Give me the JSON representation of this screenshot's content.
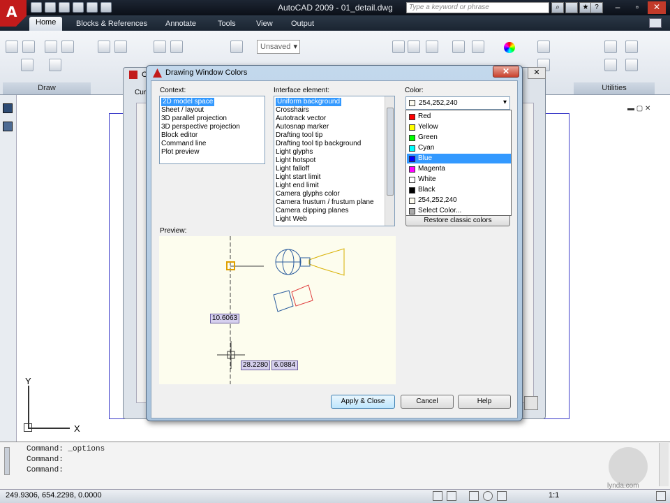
{
  "app": {
    "logo": "A",
    "window_title": "AutoCAD 2009 - 01_detail.dwg",
    "search_placeholder": "Type a keyword or phrase"
  },
  "ribbon": {
    "tabs": [
      "Home",
      "Blocks & References",
      "Annotate",
      "Tools",
      "View",
      "Output"
    ],
    "panels": {
      "draw": "Draw",
      "utilities": "Utilities"
    },
    "layer_value": "Unsaved"
  },
  "back_dialog": {
    "title": "O",
    "tab_label": "Cur"
  },
  "dialog": {
    "title": "Drawing Window Colors",
    "close_glyph": "✕",
    "context_label": "Context:",
    "context_items": [
      "2D model space",
      "Sheet / layout",
      "3D parallel projection",
      "3D perspective projection",
      "Block editor",
      "Command line",
      "Plot preview"
    ],
    "interface_label": "Interface element:",
    "interface_items": [
      "Uniform background",
      "Crosshairs",
      "Autotrack vector",
      "Autosnap marker",
      "Drafting tool tip",
      "Drafting tool tip background",
      "Light glyphs",
      "Light hotspot",
      "Light falloff",
      "Light start limit",
      "Light end limit",
      "Camera glyphs color",
      "Camera frustum / frustum plane",
      "Camera clipping planes",
      "Light Web"
    ],
    "color_label": "Color:",
    "color_value": "254,252,240",
    "color_options": [
      {
        "label": "Red",
        "swatch": "#ff0000"
      },
      {
        "label": "Yellow",
        "swatch": "#ffff00"
      },
      {
        "label": "Green",
        "swatch": "#00ff00"
      },
      {
        "label": "Cyan",
        "swatch": "#00ffff"
      },
      {
        "label": "Blue",
        "swatch": "#0000ff"
      },
      {
        "label": "Magenta",
        "swatch": "#ff00ff"
      },
      {
        "label": "White",
        "swatch": "#ffffff"
      },
      {
        "label": "Black",
        "swatch": "#000000"
      },
      {
        "label": "254,252,240",
        "swatch": "#fefcf0"
      },
      {
        "label": "Select Color...",
        "swatch": "#aaaaaa"
      }
    ],
    "restore_label": "Restore classic colors",
    "preview_label": "Preview:",
    "preview_values": {
      "v1": "10.6063",
      "v2": "28.2280",
      "v3": "6.0884"
    },
    "apply_label": "Apply & Close",
    "cancel_label": "Cancel",
    "help_label": "Help"
  },
  "command_line": [
    "Command:  _options",
    "Command:",
    "Command:"
  ],
  "status": {
    "coords": "249.9306, 654.2298, 0.0000",
    "scale": "1:1",
    "watermark": "lynda.com"
  },
  "axes": {
    "y": "Y",
    "x": "X"
  }
}
